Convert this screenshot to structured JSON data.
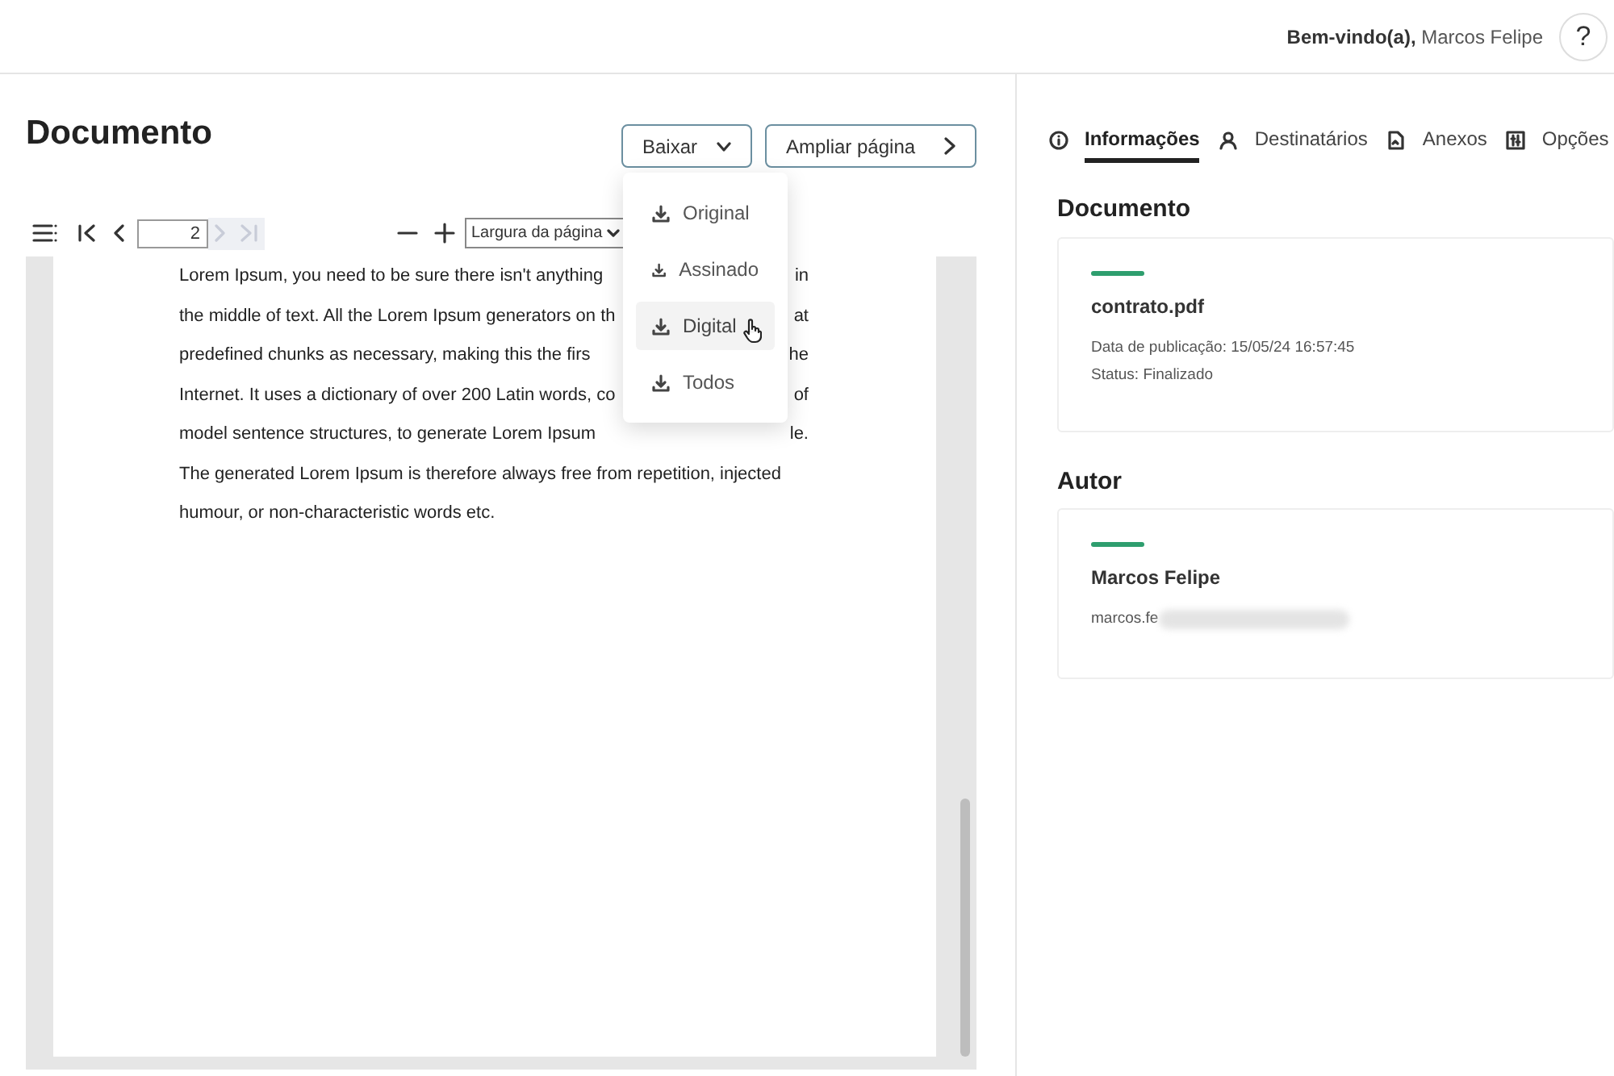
{
  "header": {
    "greeting_bold": "Bem-vindo(a),",
    "user_name": "Marcos Felipe",
    "help_label": "?"
  },
  "document_panel": {
    "title": "Documento",
    "buttons": [
      {
        "kind": "dropdown",
        "label": "Baixar",
        "expanded": true
      },
      {
        "kind": "next",
        "label": "Ampliar página"
      }
    ],
    "download_menu": [
      {
        "label": "Original",
        "hovered": false
      },
      {
        "label": "Assinado",
        "hovered": false
      },
      {
        "label": "Digital",
        "hovered": true
      },
      {
        "label": "Todos",
        "hovered": false
      }
    ],
    "toolbar": {
      "page": "2",
      "next_disabled": true,
      "zoom": "Largura da página"
    },
    "pdf_lines": [
      {
        "left": "Lorem Ipsum, you need to be sure there isn't anything",
        "right": "in"
      },
      {
        "left": "the middle of text. All the Lorem Ipsum generators on th",
        "right": "at"
      },
      {
        "left": "predefined chunks as necessary, making this the firs",
        "right": "he"
      },
      {
        "left": "Internet. It uses a dictionary of over 200 Latin words, co",
        "right": "of"
      },
      {
        "left": "model sentence structures, to generate Lorem Ipsum",
        "right": "le."
      },
      {
        "left": "The generated Lorem Ipsum is therefore always free from repetition, injected"
      },
      {
        "left": "humour, or non-characteristic words etc."
      }
    ]
  },
  "info_panel": {
    "tabs": [
      {
        "label": "Informações",
        "selected": true
      },
      {
        "label": "Destinatários",
        "selected": false
      },
      {
        "label": "Anexos",
        "selected": false
      },
      {
        "label": "Opções",
        "selected": false
      }
    ],
    "sections": [
      {
        "title": "Documento",
        "name": "contrato.pdf",
        "lines": [
          "Data de publicação: 15/05/24 16:57:45",
          "Status: Finalizado"
        ],
        "redacted": false
      },
      {
        "title": "Autor",
        "name": "Marcos Felipe",
        "lines": [
          "marcos.fe"
        ],
        "redacted": true
      }
    ]
  }
}
